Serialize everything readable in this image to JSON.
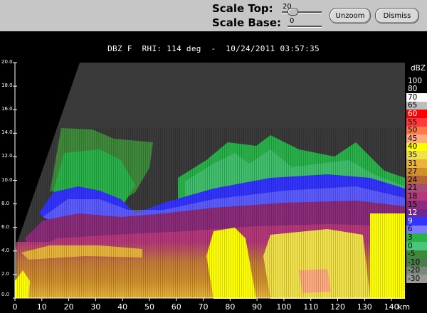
{
  "controls": {
    "scale_top_label": "Scale Top:",
    "scale_top_value": "20",
    "scale_base_label": "Scale Base:",
    "scale_base_value": "0",
    "unzoom_label": "Unzoom",
    "dismiss_label": "Dismiss"
  },
  "title": {
    "field": "DBZ F",
    "scan": "RHI: 114 deg",
    "sep": "-",
    "datetime": "10/24/2011 03:57:35"
  },
  "colors": {
    "background": "#000000",
    "panel": "#c6c6c6",
    "plot_bg": "#3a3a3a",
    "axis": "#ffffff"
  },
  "colorbar": {
    "unit": "dBZ",
    "entries": [
      {
        "label": "100",
        "color": "#000000",
        "text": "#ffffff"
      },
      {
        "label": "80",
        "color": "#000000",
        "text": "#ffffff"
      },
      {
        "label": "70",
        "color": "#ffffff",
        "text": "#000000"
      },
      {
        "label": "65",
        "color": "#bdbdbd",
        "text": "#000000"
      },
      {
        "label": "60",
        "color": "#ff0000",
        "text": "#ffffff"
      },
      {
        "label": "55",
        "color": "#ff3b3b",
        "text": "#000000"
      },
      {
        "label": "50",
        "color": "#ff7a4a",
        "text": "#000000"
      },
      {
        "label": "45",
        "color": "#ffab80",
        "text": "#000000"
      },
      {
        "label": "40",
        "color": "#ffff00",
        "text": "#000000"
      },
      {
        "label": "35",
        "color": "#f2e24a",
        "text": "#000000"
      },
      {
        "label": "31",
        "color": "#e8b43a",
        "text": "#000000"
      },
      {
        "label": "27",
        "color": "#d0902a",
        "text": "#000000"
      },
      {
        "label": "24",
        "color": "#b4663a",
        "text": "#000000"
      },
      {
        "label": "21",
        "color": "#a84c7a",
        "text": "#000000"
      },
      {
        "label": "18",
        "color": "#b4387a",
        "text": "#000000"
      },
      {
        "label": "15",
        "color": "#8a2c7a",
        "text": "#000000"
      },
      {
        "label": "12",
        "color": "#70288c",
        "text": "#ffffff"
      },
      {
        "label": "9",
        "color": "#3333ff",
        "text": "#ffffff"
      },
      {
        "label": "6",
        "color": "#7b7bff",
        "text": "#000000"
      },
      {
        "label": "3",
        "color": "#2ab24a",
        "text": "#000000"
      },
      {
        "label": "0",
        "color": "#4ac67a",
        "text": "#000000"
      },
      {
        "label": "-5",
        "color": "#3f8a3a",
        "text": "#000000"
      },
      {
        "label": "-10",
        "color": "#4c7a4c",
        "text": "#000000"
      },
      {
        "label": "-20",
        "color": "#7a8a7a",
        "text": "#000000"
      },
      {
        "label": "-30",
        "color": "#9a9a9a",
        "text": "#000000"
      }
    ]
  },
  "axes": {
    "y_ticks": [
      "20.0",
      "18.0",
      "16.0",
      "14.0",
      "12.0",
      "10.0",
      "8.0",
      "6.0",
      "4.0",
      "2.0",
      "0.0"
    ],
    "x_ticks": [
      "0",
      "10",
      "20",
      "30",
      "40",
      "50",
      "60",
      "70",
      "80",
      "90",
      "100",
      "110",
      "120",
      "130",
      "140"
    ],
    "x_unit": "km",
    "y_range": [
      0,
      20
    ],
    "x_range": [
      0,
      145
    ]
  },
  "corner_marker": "2"
}
